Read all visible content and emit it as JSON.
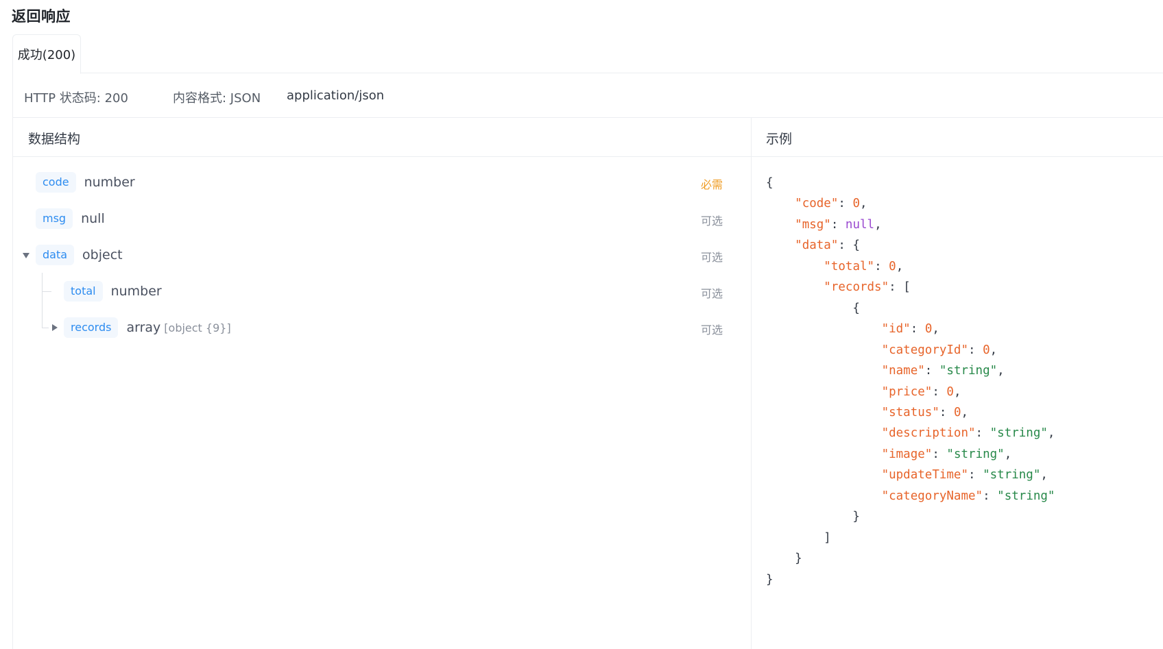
{
  "page": {
    "title": "返回响应"
  },
  "tabs": [
    {
      "label": "成功(200)",
      "active": true
    }
  ],
  "meta": {
    "status": "HTTP 状态码: 200",
    "format": "内容格式: JSON",
    "mime": "application/json"
  },
  "schema": {
    "header": "数据结构",
    "fields": [
      {
        "name": "code",
        "type": "number",
        "extra": "",
        "requirement": "必需",
        "required": true,
        "depth": 0,
        "toggle": "none"
      },
      {
        "name": "msg",
        "type": "null",
        "extra": "",
        "requirement": "可选",
        "required": false,
        "depth": 0,
        "toggle": "none"
      },
      {
        "name": "data",
        "type": "object",
        "extra": "",
        "requirement": "可选",
        "required": false,
        "depth": 0,
        "toggle": "expanded"
      },
      {
        "name": "total",
        "type": "number",
        "extra": "",
        "requirement": "可选",
        "required": false,
        "depth": 1,
        "toggle": "none"
      },
      {
        "name": "records",
        "type": "array",
        "extra": "[object {9}]",
        "requirement": "可选",
        "required": false,
        "depth": 1,
        "toggle": "collapsed"
      }
    ]
  },
  "example": {
    "header": "示例",
    "lines": [
      [
        {
          "t": "p",
          "v": "{"
        }
      ],
      [
        {
          "t": "p",
          "v": "    "
        },
        {
          "t": "key",
          "v": "\"code\""
        },
        {
          "t": "p",
          "v": ": "
        },
        {
          "t": "num",
          "v": "0"
        },
        {
          "t": "p",
          "v": ","
        }
      ],
      [
        {
          "t": "p",
          "v": "    "
        },
        {
          "t": "key",
          "v": "\"msg\""
        },
        {
          "t": "p",
          "v": ": "
        },
        {
          "t": "null",
          "v": "null"
        },
        {
          "t": "p",
          "v": ","
        }
      ],
      [
        {
          "t": "p",
          "v": "    "
        },
        {
          "t": "key",
          "v": "\"data\""
        },
        {
          "t": "p",
          "v": ": {"
        }
      ],
      [
        {
          "t": "p",
          "v": "        "
        },
        {
          "t": "key",
          "v": "\"total\""
        },
        {
          "t": "p",
          "v": ": "
        },
        {
          "t": "num",
          "v": "0"
        },
        {
          "t": "p",
          "v": ","
        }
      ],
      [
        {
          "t": "p",
          "v": "        "
        },
        {
          "t": "key",
          "v": "\"records\""
        },
        {
          "t": "p",
          "v": ": ["
        }
      ],
      [
        {
          "t": "p",
          "v": "            {"
        }
      ],
      [
        {
          "t": "p",
          "v": "                "
        },
        {
          "t": "key",
          "v": "\"id\""
        },
        {
          "t": "p",
          "v": ": "
        },
        {
          "t": "num",
          "v": "0"
        },
        {
          "t": "p",
          "v": ","
        }
      ],
      [
        {
          "t": "p",
          "v": "                "
        },
        {
          "t": "key",
          "v": "\"categoryId\""
        },
        {
          "t": "p",
          "v": ": "
        },
        {
          "t": "num",
          "v": "0"
        },
        {
          "t": "p",
          "v": ","
        }
      ],
      [
        {
          "t": "p",
          "v": "                "
        },
        {
          "t": "key",
          "v": "\"name\""
        },
        {
          "t": "p",
          "v": ": "
        },
        {
          "t": "str",
          "v": "\"string\""
        },
        {
          "t": "p",
          "v": ","
        }
      ],
      [
        {
          "t": "p",
          "v": "                "
        },
        {
          "t": "key",
          "v": "\"price\""
        },
        {
          "t": "p",
          "v": ": "
        },
        {
          "t": "num",
          "v": "0"
        },
        {
          "t": "p",
          "v": ","
        }
      ],
      [
        {
          "t": "p",
          "v": "                "
        },
        {
          "t": "key",
          "v": "\"status\""
        },
        {
          "t": "p",
          "v": ": "
        },
        {
          "t": "num",
          "v": "0"
        },
        {
          "t": "p",
          "v": ","
        }
      ],
      [
        {
          "t": "p",
          "v": "                "
        },
        {
          "t": "key",
          "v": "\"description\""
        },
        {
          "t": "p",
          "v": ": "
        },
        {
          "t": "str",
          "v": "\"string\""
        },
        {
          "t": "p",
          "v": ","
        }
      ],
      [
        {
          "t": "p",
          "v": "                "
        },
        {
          "t": "key",
          "v": "\"image\""
        },
        {
          "t": "p",
          "v": ": "
        },
        {
          "t": "str",
          "v": "\"string\""
        },
        {
          "t": "p",
          "v": ","
        }
      ],
      [
        {
          "t": "p",
          "v": "                "
        },
        {
          "t": "key",
          "v": "\"updateTime\""
        },
        {
          "t": "p",
          "v": ": "
        },
        {
          "t": "str",
          "v": "\"string\""
        },
        {
          "t": "p",
          "v": ","
        }
      ],
      [
        {
          "t": "p",
          "v": "                "
        },
        {
          "t": "key",
          "v": "\"categoryName\""
        },
        {
          "t": "p",
          "v": ": "
        },
        {
          "t": "str",
          "v": "\"string\""
        }
      ],
      [
        {
          "t": "p",
          "v": "            }"
        }
      ],
      [
        {
          "t": "p",
          "v": "        ]"
        }
      ],
      [
        {
          "t": "p",
          "v": "    }"
        }
      ],
      [
        {
          "t": "p",
          "v": "}"
        }
      ]
    ]
  },
  "colors": {
    "tag_text": "#2d8cf0",
    "tag_bg": "#f2f7fd",
    "required": "#ef9c23",
    "json_key": "#e7642a",
    "json_number": "#e7642a",
    "json_null": "#9a4ad0",
    "json_string": "#28894a"
  }
}
